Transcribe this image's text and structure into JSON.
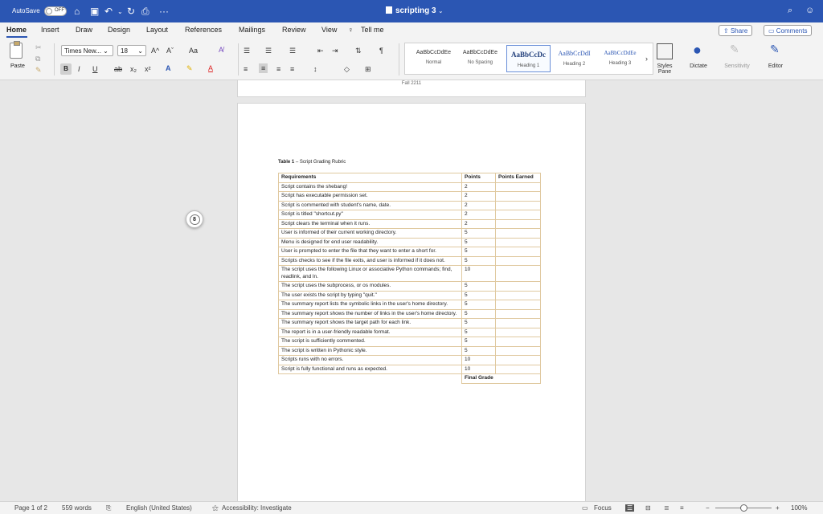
{
  "titlebar": {
    "autosave_label": "AutoSave",
    "autosave_state": "OFF",
    "doc_title": "scripting 3",
    "doc_title_chevron": "⌄",
    "quick_icons": [
      "home-icon",
      "save-icon",
      "undo-icon",
      "redo-icon",
      "print-icon",
      "more-icon"
    ],
    "more_glyph": "···"
  },
  "menu": {
    "tabs": [
      "Home",
      "Insert",
      "Draw",
      "Design",
      "Layout",
      "References",
      "Mailings",
      "Review",
      "View"
    ],
    "tell_me": "Tell me",
    "share": "Share",
    "comments": "Comments"
  },
  "ribbon": {
    "paste_label": "Paste",
    "font_name": "Times New...",
    "font_size": "18",
    "bold": "B",
    "italic": "I",
    "underline": "U",
    "strike": "ab",
    "subscript": "x₂",
    "superscript": "x²",
    "grow_font": "A^",
    "shrink_font": "Aˇ",
    "case": "Aa",
    "styles": [
      {
        "preview": "AaBbCcDdEe",
        "name": "Normal"
      },
      {
        "preview": "AaBbCcDdEe",
        "name": "No Spacing"
      },
      {
        "preview": "AaBbCcDc",
        "name": "Heading 1"
      },
      {
        "preview": "AaBbCcDdI",
        "name": "Heading 2"
      },
      {
        "preview": "AaBbCcDdEe",
        "name": "Heading 3"
      }
    ],
    "styles_pane": "Styles Pane",
    "dictate": "Dictate",
    "sensitivity": "Sensitivity",
    "editor": "Editor"
  },
  "document": {
    "prev_footer": "Fall 2211",
    "table_caption_bold": "Table 1",
    "table_caption_rest": " – Script Grading Rubric",
    "headers": [
      "Requirements",
      "Points",
      "Points Earned"
    ],
    "rows": [
      [
        "Script contains the shebang!",
        "2",
        ""
      ],
      [
        "Script has executable permission set.",
        "2",
        ""
      ],
      [
        "Script is commented with student's name, date.",
        "2",
        ""
      ],
      [
        "Script is titled \"shortcut.py\"",
        "2",
        ""
      ],
      [
        "Script clears the terminal when it runs.",
        "2",
        ""
      ],
      [
        "User is informed of their current working directory.",
        "5",
        ""
      ],
      [
        "Menu is designed for end user readability.",
        "5",
        ""
      ],
      [
        "User is prompted to enter the file that they want to enter a short for.",
        "5",
        ""
      ],
      [
        "Scripts checks to see if the file exits, and user is informed if it does not.",
        "5",
        ""
      ],
      [
        "The script uses the following Linux or associative Python commands; find, readlink, and ln.",
        "10",
        ""
      ],
      [
        "The script uses the subprocess, or os modules.",
        "5",
        ""
      ],
      [
        "The user exists the script by typing \"quit.\"",
        "5",
        ""
      ],
      [
        "The summary report lists the symbolic links in the user's home directory.",
        "5",
        ""
      ],
      [
        "The summary report shows the number of links in the user's home directory.",
        "5",
        ""
      ],
      [
        "The summary report shows the target path for each link.",
        "5",
        ""
      ],
      [
        "The report is in a user-friendly readable format.",
        "5",
        ""
      ],
      [
        "The script is sufficiently commented.",
        "5",
        ""
      ],
      [
        "The script is written in Pythonic style.",
        "5",
        ""
      ],
      [
        "Scripts runs with no errors.",
        "10",
        ""
      ],
      [
        "Script is fully functional and runs as expected.",
        "10",
        ""
      ]
    ],
    "final_grade": "Final Grade",
    "comment_count": "8"
  },
  "status": {
    "page": "Page 1 of 2",
    "words": "559 words",
    "language": "English (United States)",
    "accessibility": "Accessibility: Investigate",
    "focus": "Focus",
    "zoom": "100%",
    "zoom_minus": "−",
    "zoom_plus": "+"
  }
}
